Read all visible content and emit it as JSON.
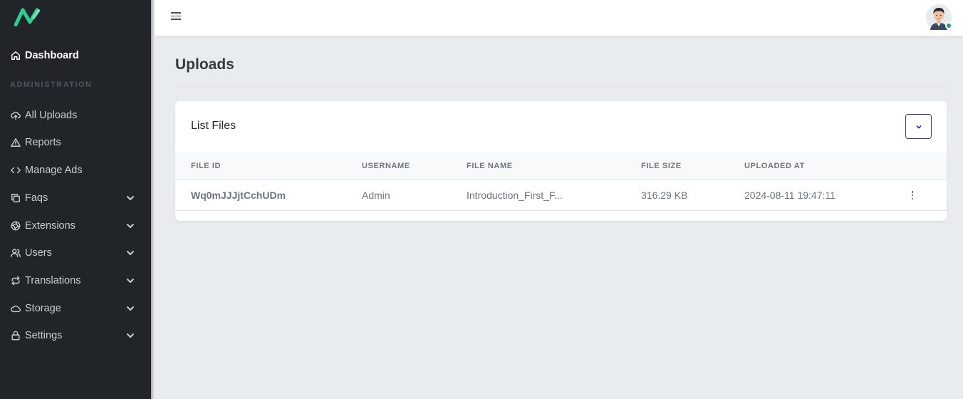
{
  "sidebar": {
    "logo": "logo-icon",
    "dashboard": {
      "label": "Dashboard",
      "icon": "home-icon"
    },
    "section_label": "ADMINISTRATION",
    "items": [
      {
        "label": "All Uploads",
        "icon": "cloud-upload-icon",
        "has_submenu": false
      },
      {
        "label": "Reports",
        "icon": "warning-triangle-icon",
        "has_submenu": false
      },
      {
        "label": "Manage Ads",
        "icon": "code-icon",
        "has_submenu": false
      },
      {
        "label": "Faqs",
        "icon": "copy-icon",
        "has_submenu": true
      },
      {
        "label": "Extensions",
        "icon": "aperture-icon",
        "has_submenu": true
      },
      {
        "label": "Users",
        "icon": "users-icon",
        "has_submenu": true
      },
      {
        "label": "Translations",
        "icon": "repeat-icon",
        "has_submenu": true
      },
      {
        "label": "Storage",
        "icon": "cloud-icon",
        "has_submenu": true
      },
      {
        "label": "Settings",
        "icon": "lock-icon",
        "has_submenu": true
      }
    ]
  },
  "topbar": {
    "menu_icon": "hamburger-icon",
    "avatar_status": "online"
  },
  "page": {
    "title": "Uploads"
  },
  "card": {
    "title": "List Files",
    "collapse_icon": "chevron-down-icon",
    "columns": [
      "FILE ID",
      "USERNAME",
      "FILE NAME",
      "FILE SIZE",
      "UPLOADED AT"
    ],
    "rows": [
      {
        "file_id": "Wq0mJJJjtCchUDm",
        "username": "Admin",
        "file_name": "Introduction_First_F...",
        "file_size": "316.29 KB",
        "uploaded_at": "2024-08-11 19:47:11"
      }
    ]
  },
  "colors": {
    "sidebar_bg": "#212529",
    "accent": "#3d3b8e",
    "logo_green": "#2ecc8f",
    "online": "#2f9e63",
    "page_bg": "#e9ecef"
  }
}
